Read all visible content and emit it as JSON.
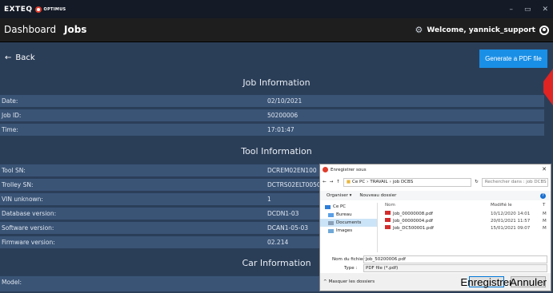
{
  "titlebar": {
    "logo_text": "EXTEQ",
    "product": "OPTIMUS",
    "controls": [
      "–",
      "▭",
      "✕"
    ]
  },
  "nav": {
    "dashboard": "Dashboard",
    "jobs": "Jobs",
    "welcome": "Welcome, yannick_support"
  },
  "back_label": "Back",
  "generate_pdf": "Generate a PDF file",
  "job_info": {
    "title": "Job Information",
    "rows": [
      {
        "label": "Date:",
        "value": "02/10/2021"
      },
      {
        "label": "Job ID:",
        "value": "50200006"
      },
      {
        "label": "Time:",
        "value": "17:01:47"
      }
    ]
  },
  "tool_info": {
    "title": "Tool Information",
    "rows": [
      {
        "label": "Tool SN:",
        "value": "DCREM02EN100"
      },
      {
        "label": "Trolley SN:",
        "value": "DCTRS02ELT005C"
      },
      {
        "label": "VIN unknown:",
        "value": "1"
      },
      {
        "label": "Database version:",
        "value": "DCDN1-03"
      },
      {
        "label": "Software version:",
        "value": "DCAN1-05-03"
      },
      {
        "label": "Firmware version:",
        "value": "02.214"
      }
    ]
  },
  "car_info": {
    "title": "Car Information",
    "rows": [
      {
        "label": "Model:",
        "value": ""
      }
    ]
  },
  "dialog": {
    "title": "Enregistrer sous",
    "path": [
      "Ce PC",
      "TRAVAIL",
      "job DCBS"
    ],
    "search_placeholder": "Rechercher dans : job DCBS",
    "organize": "Organiser ▾",
    "new_folder": "Nouveau dossier",
    "nav_items": [
      "Ce PC",
      "Bureau",
      "Documents",
      "Images"
    ],
    "col_name": "Nom",
    "col_modified": "Modifié le",
    "col_type": "T",
    "files": [
      {
        "name": "Job_00000008.pdf",
        "date": "10/12/2020 14:01",
        "type": "M"
      },
      {
        "name": "Job_00000004.pdf",
        "date": "20/01/2021 11:57",
        "type": "M"
      },
      {
        "name": "Job_DC500001.pdf",
        "date": "15/01/2021 09:07",
        "type": "M"
      }
    ],
    "filename_label": "Nom du fichier :",
    "filename_value": "Job_50200006.pdf",
    "type_label": "Type :",
    "type_value": "PDF file (*.pdf)",
    "hide_folders": "Masquer les dossiers",
    "save": "Enregistrer",
    "cancel": "Annuler"
  }
}
